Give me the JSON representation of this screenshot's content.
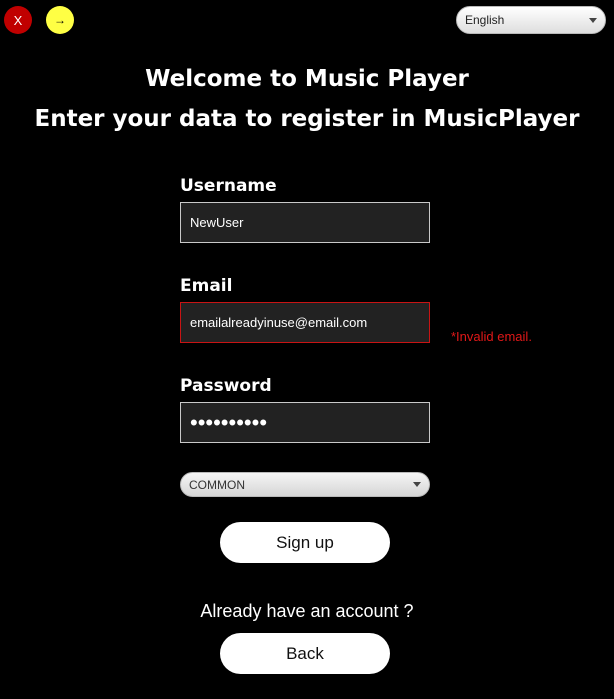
{
  "window": {
    "close_label": "X",
    "minimize_label": "→"
  },
  "language": {
    "selected": "English"
  },
  "header": {
    "title": "Welcome to Music Player",
    "subtitle": "Enter your data to register in MusicPlayer"
  },
  "form": {
    "username_label": "Username",
    "username_value": "NewUser",
    "email_label": "Email",
    "email_value": "emailalreadyinuse@email.com",
    "email_error": "*Invalid email.",
    "password_label": "Password",
    "password_value": "••••••••••",
    "role_selected": "COMMON"
  },
  "actions": {
    "signup_label": "Sign up",
    "already_account_text": "Already have an account ?",
    "back_label": "Back"
  },
  "colors": {
    "background": "#000000",
    "close_button": "#c00000",
    "minimize_button": "#ffff44",
    "error": "#e01818",
    "field_background": "#222222"
  }
}
